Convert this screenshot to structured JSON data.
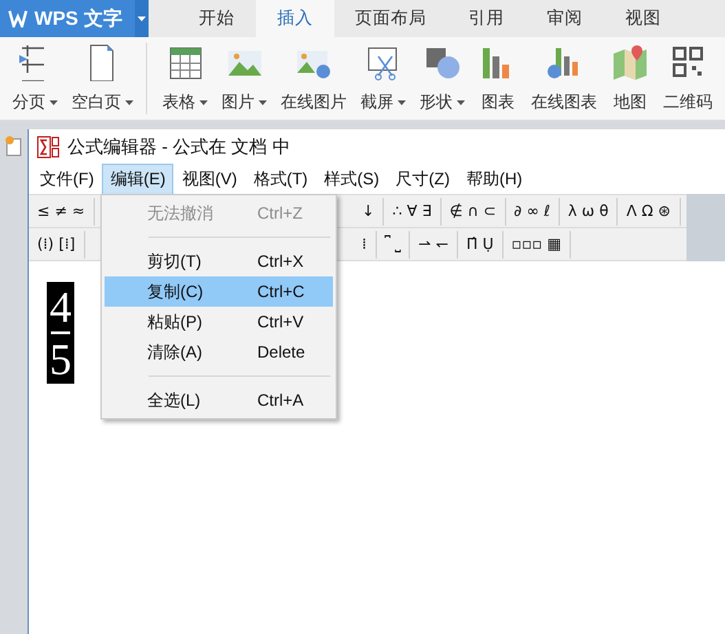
{
  "app": {
    "title": "WPS 文字"
  },
  "tabs": [
    {
      "label": "开始",
      "selected": false
    },
    {
      "label": "插入",
      "selected": true
    },
    {
      "label": "页面布局",
      "selected": false
    },
    {
      "label": "引用",
      "selected": false
    },
    {
      "label": "审阅",
      "selected": false
    },
    {
      "label": "视图",
      "selected": false
    }
  ],
  "ribbon": {
    "groups": [
      [
        {
          "label": "分页",
          "has_menu": true
        },
        {
          "label": "空白页",
          "has_menu": true
        }
      ],
      [
        {
          "label": "表格",
          "has_menu": true
        },
        {
          "label": "图片",
          "has_menu": true
        },
        {
          "label": "在线图片",
          "has_menu": false
        },
        {
          "label": "截屏",
          "has_menu": true
        },
        {
          "label": "形状",
          "has_menu": true
        },
        {
          "label": "图表",
          "has_menu": false
        },
        {
          "label": "在线图表",
          "has_menu": false
        },
        {
          "label": "地图",
          "has_menu": false
        },
        {
          "label": "二维码",
          "has_menu": false
        }
      ]
    ]
  },
  "editor": {
    "title": "公式编辑器 - 公式在 文档 中",
    "menus": [
      {
        "label": "文件(F)",
        "selected": false
      },
      {
        "label": "编辑(E)",
        "selected": true
      },
      {
        "label": "视图(V)",
        "selected": false
      },
      {
        "label": "格式(T)",
        "selected": false
      },
      {
        "label": "样式(S)",
        "selected": false
      },
      {
        "label": "尺寸(Z)",
        "selected": false
      },
      {
        "label": "帮助(H)",
        "selected": false
      }
    ],
    "toolbar": {
      "rows": [
        {
          "left": [
            "≤ ≠ ≈"
          ],
          "right": [
            "↓",
            "∴ ∀ ∃",
            "∉ ∩ ⊂",
            "∂ ∞ ℓ",
            "λ ω θ",
            "Λ Ω ⊛"
          ]
        },
        {
          "left": [
            "(⁞) [⁞]"
          ],
          "right": [
            "⁞",
            "⎴ ⎵",
            "⇀ ↽",
            "Π̂ Ụ",
            "▫▫▫ ▦"
          ]
        }
      ]
    },
    "fraction": {
      "numerator": "4",
      "denominator": "5"
    },
    "edit_menu": {
      "items": [
        {
          "kind": "item",
          "label": "无法撤消",
          "shortcut": "Ctrl+Z",
          "disabled": true,
          "selected": false
        },
        {
          "kind": "separator"
        },
        {
          "kind": "item",
          "label": "剪切(T)",
          "shortcut": "Ctrl+X",
          "disabled": false,
          "selected": false
        },
        {
          "kind": "item",
          "label": "复制(C)",
          "shortcut": "Ctrl+C",
          "disabled": false,
          "selected": true
        },
        {
          "kind": "item",
          "label": "粘贴(P)",
          "shortcut": "Ctrl+V",
          "disabled": false,
          "selected": false
        },
        {
          "kind": "item",
          "label": "清除(A)",
          "shortcut": "Delete",
          "disabled": false,
          "selected": false
        },
        {
          "kind": "separator"
        },
        {
          "kind": "item",
          "label": "全选(L)",
          "shortcut": "Ctrl+A",
          "disabled": false,
          "selected": false
        }
      ]
    }
  }
}
